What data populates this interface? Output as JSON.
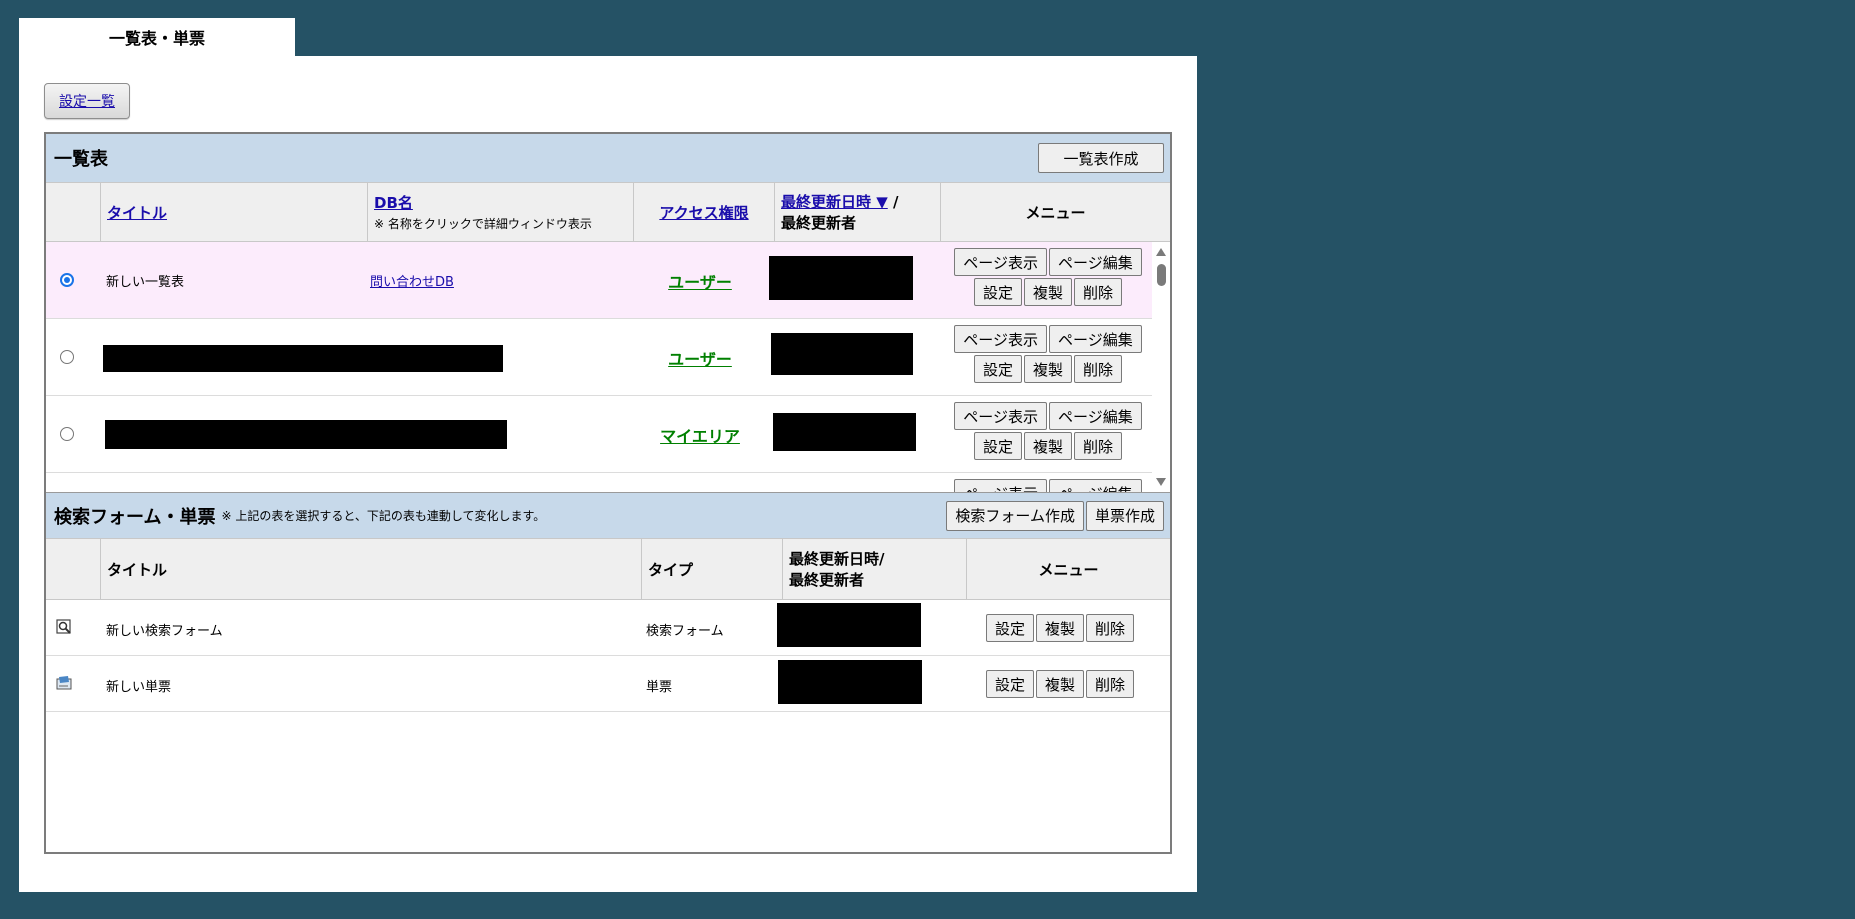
{
  "tab": {
    "label": "一覧表・単票"
  },
  "settings_button": {
    "label": "設定一覧"
  },
  "list_section": {
    "title": "一覧表",
    "create_button": "一覧表作成",
    "headers": {
      "title": "タイトル",
      "db_name": "DB名",
      "db_note": "※ 名称をクリックで詳細ウィンドウ表示",
      "access": "アクセス権限",
      "updated": "最終更新日時 ▼",
      "slash": " /",
      "updater": "最終更新者",
      "menu": "メニュー"
    },
    "rows": [
      {
        "title": "新しい一覧表",
        "db": "問い合わせDB",
        "access": "ユーザー",
        "selected": true
      },
      {
        "title": "",
        "db": "",
        "access": "ユーザー",
        "selected": false
      },
      {
        "title": "",
        "db": "",
        "access": "マイエリア",
        "selected": false
      },
      {
        "title": "",
        "db": "",
        "access": "",
        "selected": false
      }
    ],
    "row_buttons": {
      "page_view": "ページ表示",
      "page_edit": "ページ編集",
      "settings": "設定",
      "copy": "複製",
      "delete": "削除"
    }
  },
  "form_section": {
    "title": "検索フォーム・単票",
    "note": "※ 上記の表を選択すると、下記の表も連動して変化します。",
    "create_search_button": "検索フォーム作成",
    "create_card_button": "単票作成",
    "headers": {
      "title": "タイトル",
      "type": "タイプ",
      "updated": "最終更新日時/",
      "updater": "最終更新者",
      "menu": "メニュー"
    },
    "rows": [
      {
        "title": "新しい検索フォーム",
        "type": "検索フォーム",
        "icon": "magnifier-form-icon"
      },
      {
        "title": "新しい単票",
        "type": "単票",
        "icon": "card-form-icon"
      }
    ],
    "row_buttons": {
      "settings": "設定",
      "copy": "複製",
      "delete": "削除"
    }
  },
  "colors": {
    "background": "#255265",
    "section_header": "#c7d9ea",
    "selected_row": "#fcecfc",
    "access_link": "#008000"
  }
}
